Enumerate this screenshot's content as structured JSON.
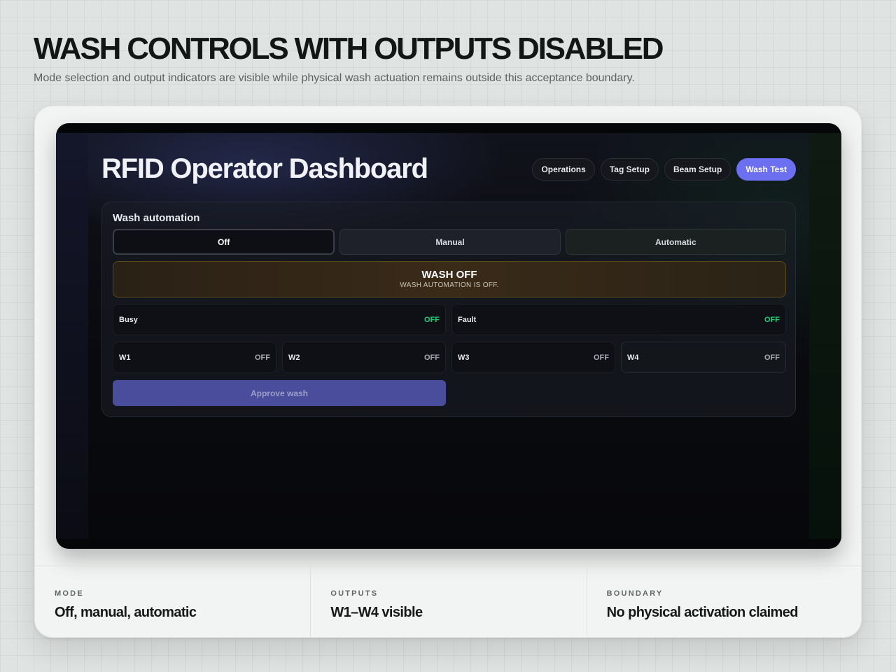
{
  "page": {
    "title": "WASH CONTROLS WITH OUTPUTS DISABLED",
    "subtitle": "Mode selection and output indicators are visible while physical wash actuation remains outside this acceptance boundary."
  },
  "dashboard": {
    "title": "RFID Operator Dashboard",
    "nav": [
      {
        "label": "Operations",
        "active": false
      },
      {
        "label": "Tag Setup",
        "active": false
      },
      {
        "label": "Beam Setup",
        "active": false
      },
      {
        "label": "Wash Test",
        "active": true
      }
    ],
    "wash": {
      "label": "Wash automation",
      "modes": [
        "Off",
        "Manual",
        "Automatic"
      ],
      "selected_mode": "Off",
      "banner_title": "WASH OFF",
      "banner_sub": "WASH AUTOMATION IS OFF.",
      "status": [
        {
          "name": "Busy",
          "value": "OFF"
        },
        {
          "name": "Fault",
          "value": "OFF"
        }
      ],
      "outputs": [
        {
          "name": "W1",
          "value": "OFF"
        },
        {
          "name": "W2",
          "value": "OFF"
        },
        {
          "name": "W3",
          "value": "OFF"
        },
        {
          "name": "W4",
          "value": "OFF"
        }
      ],
      "approve_label": "Approve wash"
    }
  },
  "footer": [
    {
      "label": "MODE",
      "value": "Off, manual, automatic"
    },
    {
      "label": "OUTPUTS",
      "value": "W1–W4 visible"
    },
    {
      "label": "BOUNDARY",
      "value": "No physical activation claimed"
    }
  ],
  "colors": {
    "accent": "#6b6ff0",
    "status_green": "#1fcf7a",
    "banner_border": "#5d4a1c"
  }
}
